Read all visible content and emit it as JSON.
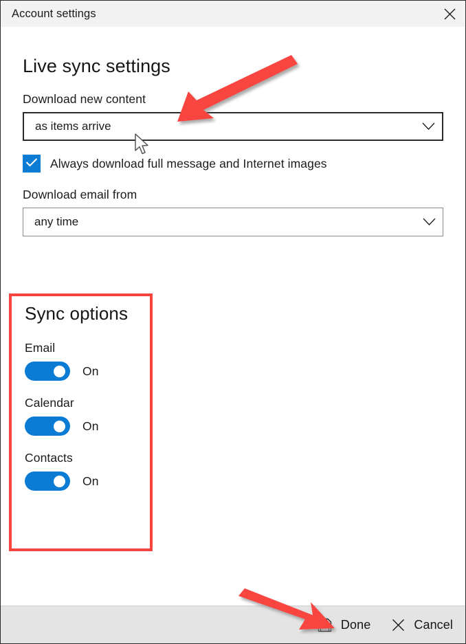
{
  "window": {
    "title": "Account settings",
    "close_icon": "close-icon"
  },
  "main": {
    "heading": "Live sync settings",
    "fields": [
      {
        "label": "Download new content",
        "value": "as items arrive",
        "chevron": "chevron-down-icon"
      },
      {
        "label": "Download email from",
        "value": "any time",
        "chevron": "chevron-down-icon"
      }
    ],
    "checkbox": {
      "label": "Always download full message and Internet images",
      "checked": true,
      "icon": "checkmark-icon"
    }
  },
  "sync_options": {
    "heading": "Sync options",
    "toggles": [
      {
        "name": "Email",
        "state": "On"
      },
      {
        "name": "Calendar",
        "state": "On"
      },
      {
        "name": "Contacts",
        "state": "On"
      }
    ]
  },
  "footer": {
    "done": {
      "label": "Done",
      "icon": "save-floppy-icon"
    },
    "cancel": {
      "label": "Cancel",
      "icon": "close-x-icon"
    }
  },
  "colors": {
    "accent": "#0b7bd4",
    "annotation": "#f8443f",
    "titlebar": "#f2f2f2",
    "footer": "#e4e4e4"
  }
}
